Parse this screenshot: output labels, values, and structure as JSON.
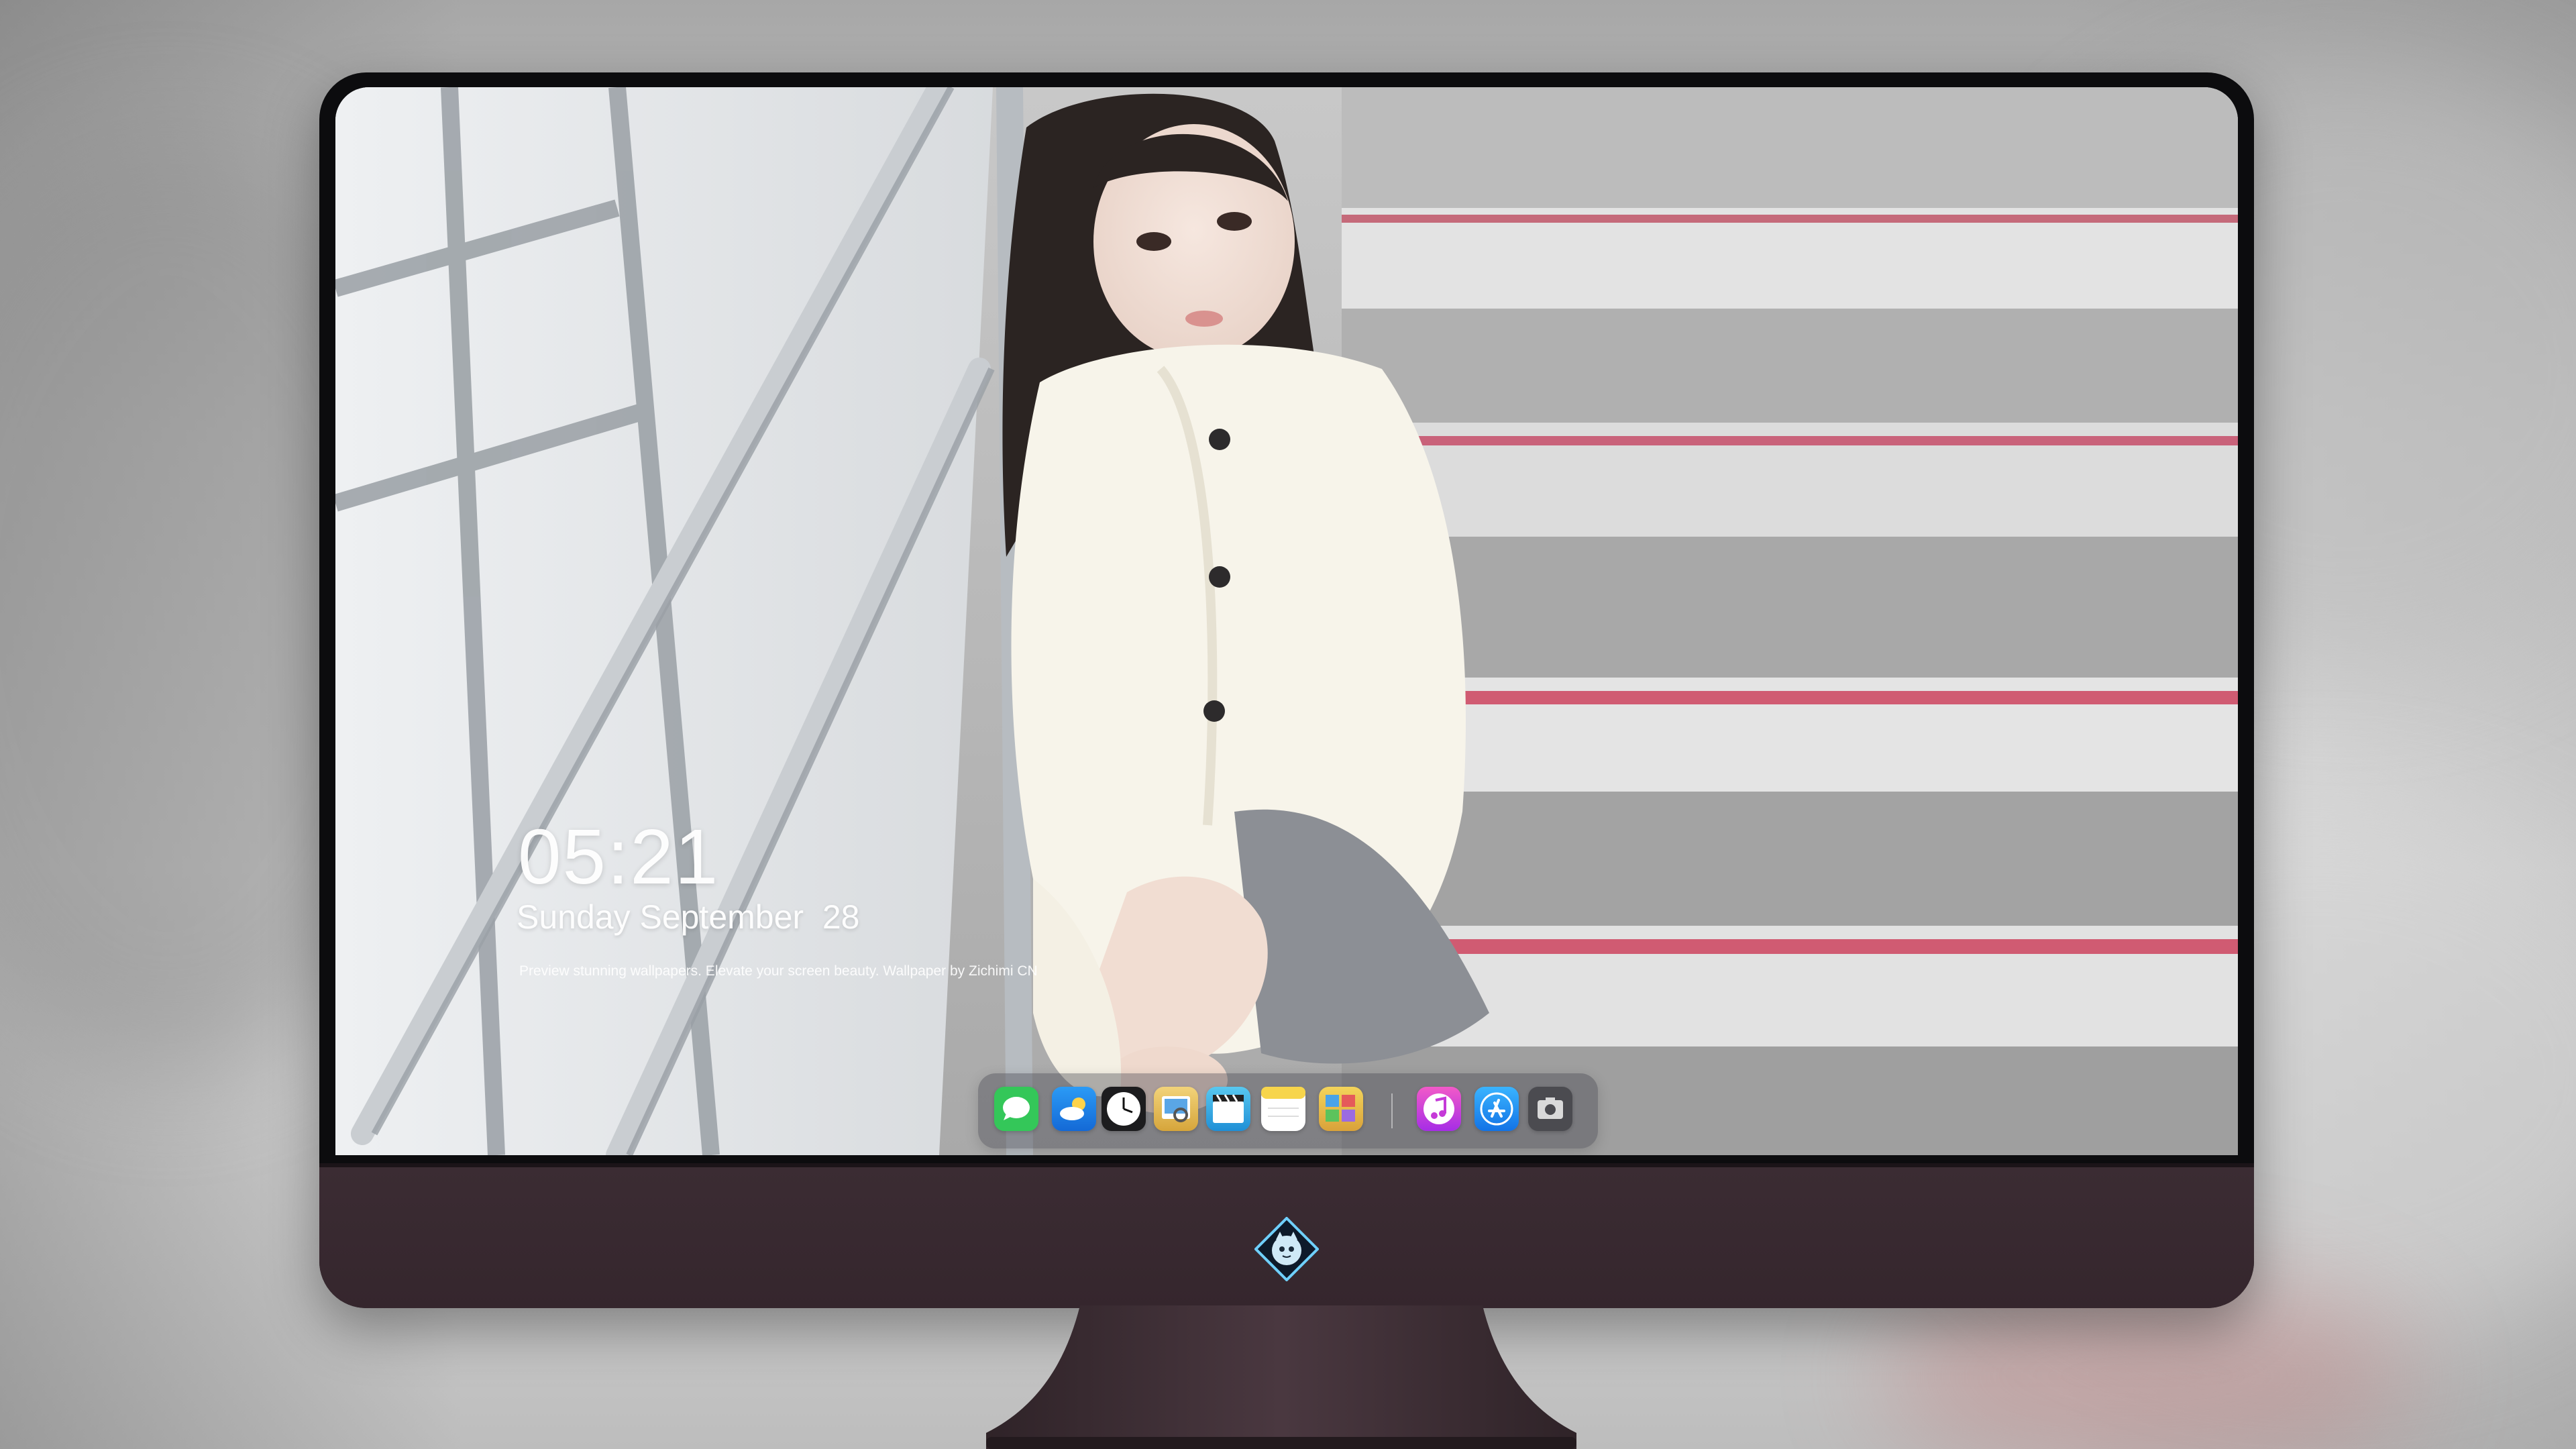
{
  "lockscreen": {
    "time": "05:21",
    "date": "Sunday September  28",
    "tagline": "Preview stunning wallpapers. Elevate your screen beauty. Wallpaper by Zichimi CN"
  },
  "dock": {
    "apps": [
      {
        "name": "messages-icon",
        "color": "#34c759"
      },
      {
        "name": "weather-icon",
        "color": "#1a86f0"
      },
      {
        "name": "clock-icon",
        "color": "#1c1c1e"
      },
      {
        "name": "preview-icon",
        "color": "#e9c35a"
      },
      {
        "name": "clips-icon",
        "color": "#33b4e8"
      },
      {
        "name": "notes-icon",
        "color": "#f7d54b"
      },
      {
        "name": "photo-booth-icon",
        "color": "#e8c24c"
      },
      {
        "name": "itunes-icon",
        "color": "#d536e6"
      },
      {
        "name": "app-store-icon",
        "color": "#1b8cf5"
      },
      {
        "name": "screenshot-icon",
        "color": "#505054"
      }
    ]
  },
  "colors": {
    "bezel": "#0c0c0e",
    "chin": "#3b2c33",
    "stand": "#3a2d33"
  }
}
